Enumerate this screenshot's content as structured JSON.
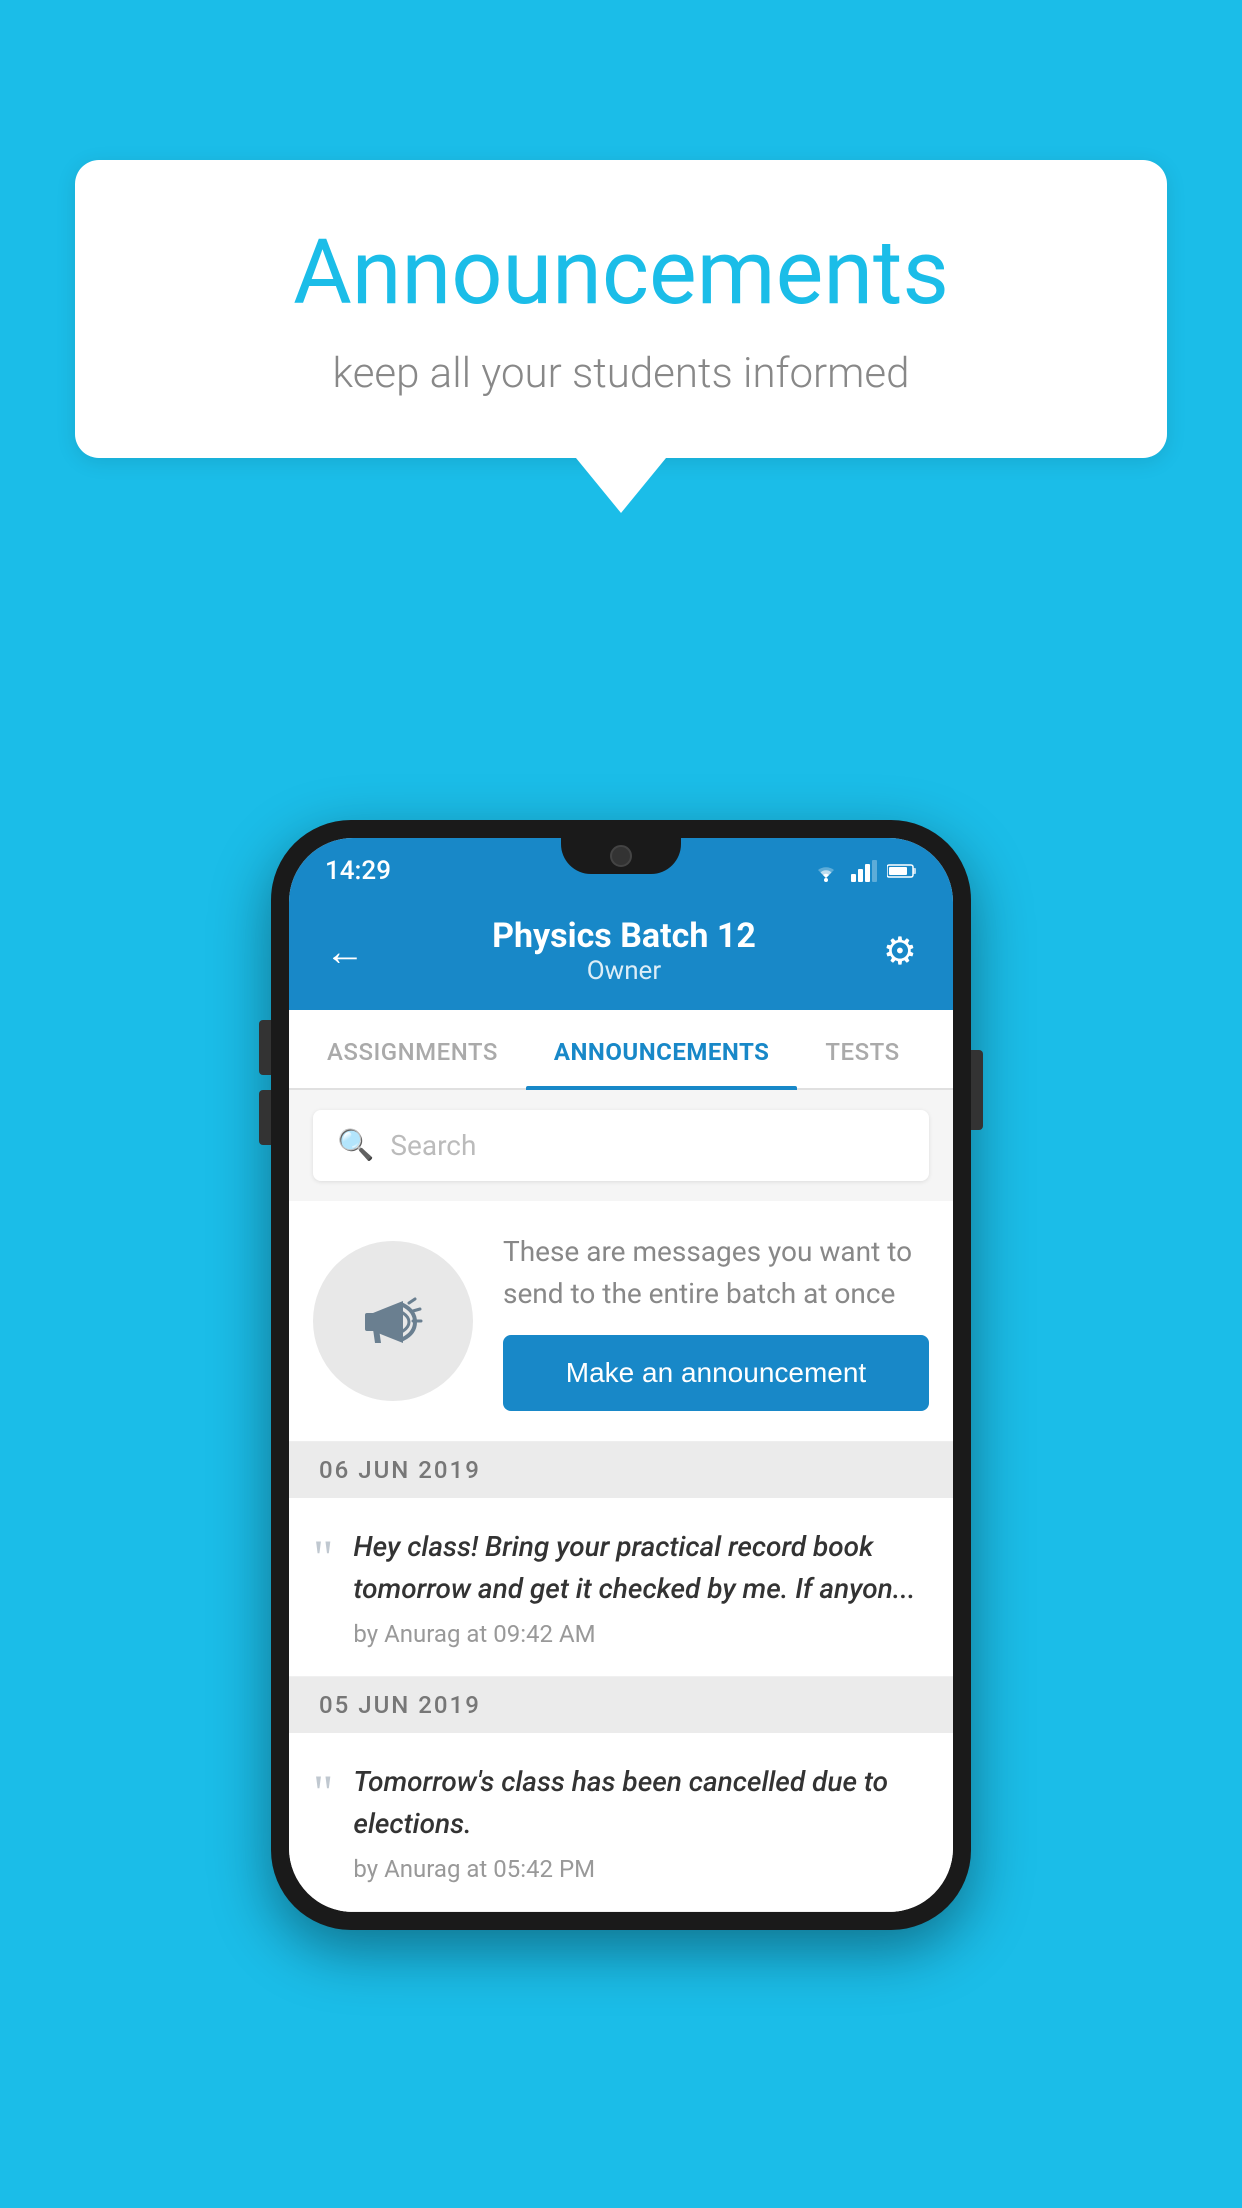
{
  "bubble": {
    "title": "Announcements",
    "subtitle": "keep all your students informed"
  },
  "statusBar": {
    "time": "14:29",
    "wifi": "wifi-icon",
    "signal": "signal-icon",
    "battery": "battery-icon"
  },
  "header": {
    "back_label": "←",
    "title": "Physics Batch 12",
    "subtitle": "Owner",
    "gear_label": "⚙"
  },
  "tabs": [
    {
      "label": "ASSIGNMENTS",
      "active": false
    },
    {
      "label": "ANNOUNCEMENTS",
      "active": true
    },
    {
      "label": "TESTS",
      "active": false
    }
  ],
  "search": {
    "placeholder": "Search"
  },
  "promo": {
    "description": "These are messages you want to send to the entire batch at once",
    "button_label": "Make an announcement"
  },
  "announcements": [
    {
      "date": "06  JUN  2019",
      "text": "Hey class! Bring your practical record book tomorrow and get it checked by me. If anyon...",
      "meta": "by Anurag at 09:42 AM"
    },
    {
      "date": "05  JUN  2019",
      "text": "Tomorrow's class has been cancelled due to elections.",
      "meta": "by Anurag at 05:42 PM"
    }
  ]
}
